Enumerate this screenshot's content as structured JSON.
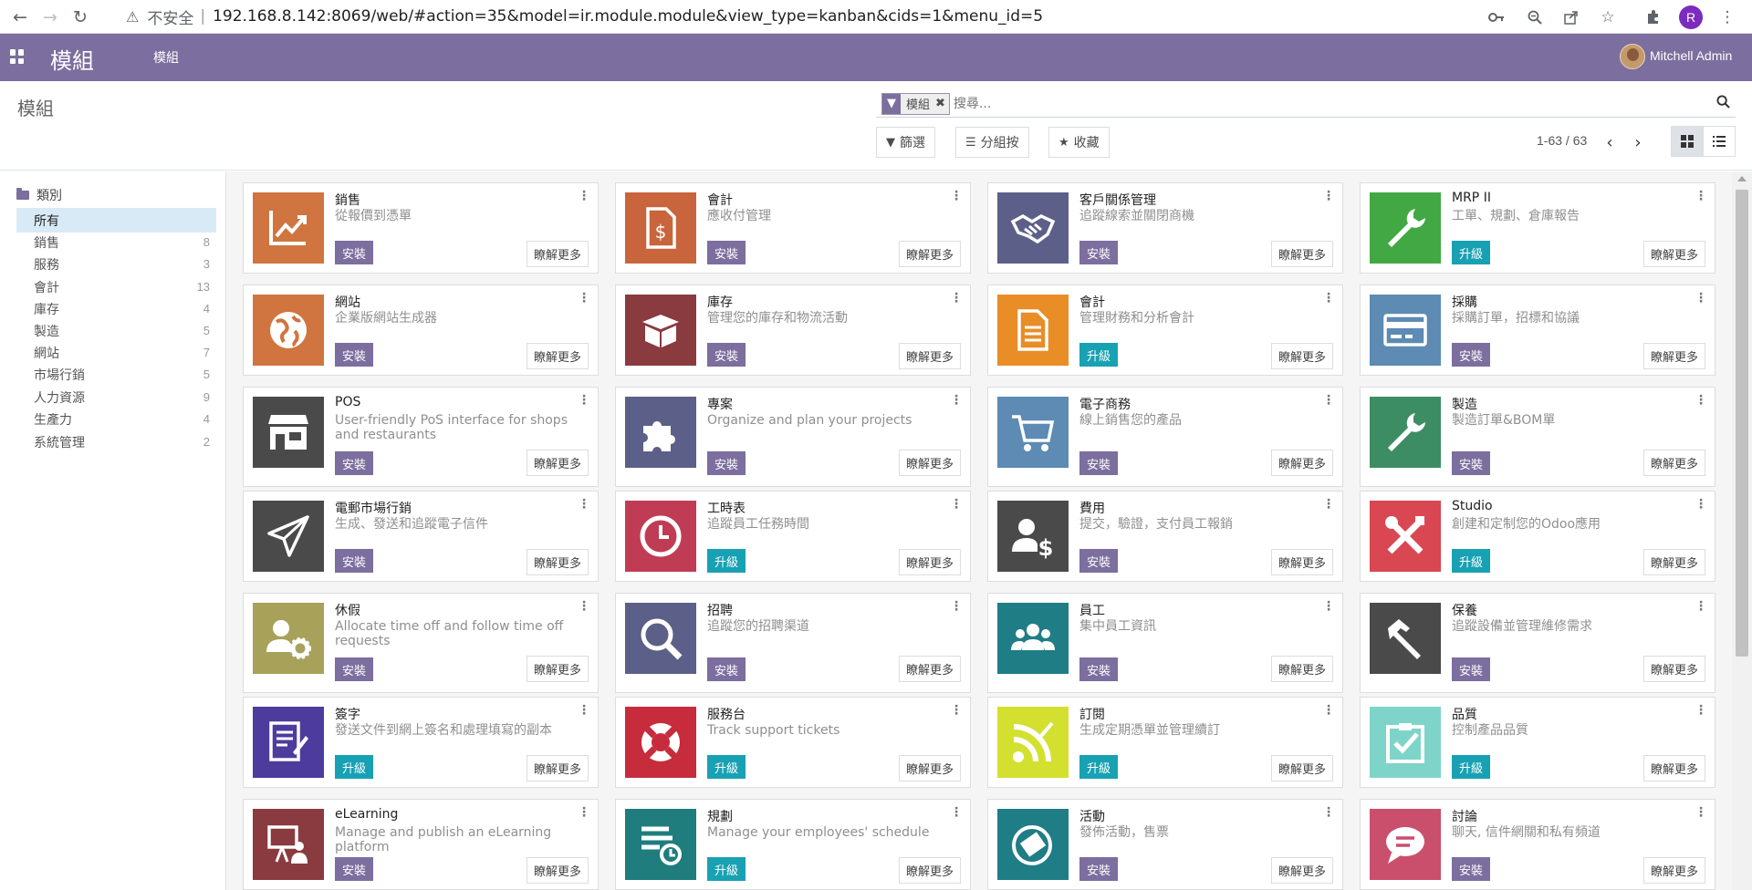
{
  "browser": {
    "insecure_label": "不安全",
    "url": "192.168.8.142:8069/web/#action=35&model=ir.module.module&view_type=kanban&cids=1&menu_id=5",
    "profile_initial": "R"
  },
  "navbar": {
    "brand": "模組",
    "menu_link": "模組",
    "user_name": "Mitchell Admin",
    "color": "#7c6e9e"
  },
  "control": {
    "title": "模組",
    "facet_label": "模組",
    "search_placeholder": "搜尋...",
    "filter_label": "篩選",
    "groupby_label": "分組按",
    "favorites_label": "收藏",
    "pager": "1-63 / 63"
  },
  "sidebar": {
    "heading": "類別",
    "items": [
      {
        "label": "所有",
        "count": ""
      },
      {
        "label": "銷售",
        "count": "8"
      },
      {
        "label": "服務",
        "count": "3"
      },
      {
        "label": "會計",
        "count": "13"
      },
      {
        "label": "庫存",
        "count": "4"
      },
      {
        "label": "製造",
        "count": "5"
      },
      {
        "label": "網站",
        "count": "7"
      },
      {
        "label": "市場行銷",
        "count": "5"
      },
      {
        "label": "人力資源",
        "count": "9"
      },
      {
        "label": "生產力",
        "count": "4"
      },
      {
        "label": "系統管理",
        "count": "2"
      }
    ]
  },
  "labels": {
    "install": "安裝",
    "upgrade": "升級",
    "learn_more": "瞭解更多"
  },
  "modules": [
    {
      "title": "銷售",
      "desc": "從報價到憑單",
      "action": "install",
      "color": "#d0753f",
      "icon": "chart-icon"
    },
    {
      "title": "會計",
      "desc": "應收付管理",
      "action": "install",
      "color": "#c9653c",
      "icon": "invoice-icon"
    },
    {
      "title": "客戶關係管理",
      "desc": "追蹤線索並關閉商機",
      "action": "install",
      "color": "#5c5f87",
      "icon": "handshake-icon"
    },
    {
      "title": "MRP II",
      "desc": "工單、規劃、倉庫報告",
      "action": "upgrade",
      "color": "#42a844",
      "icon": "wrench-icon"
    },
    {
      "title": "網站",
      "desc": "企業版網站生成器",
      "action": "install",
      "color": "#d0753f",
      "icon": "globe-icon"
    },
    {
      "title": "庫存",
      "desc": "管理您的庫存和物流活動",
      "action": "install",
      "color": "#8a3b3f",
      "icon": "box-icon"
    },
    {
      "title": "會計",
      "desc": "管理財務和分析會計",
      "action": "upgrade",
      "color": "#e98d27",
      "icon": "document-icon"
    },
    {
      "title": "採購",
      "desc": "採購訂單，招標和協議",
      "action": "install",
      "color": "#5d8bb3",
      "icon": "credit-card-icon"
    },
    {
      "title": "POS",
      "desc": "User-friendly PoS interface for shops and restaurants",
      "action": "install",
      "color": "#4a4a4a",
      "icon": "store-icon"
    },
    {
      "title": "專案",
      "desc": "Organize and plan your projects",
      "action": "install",
      "color": "#5c5f87",
      "icon": "puzzle-icon"
    },
    {
      "title": "電子商務",
      "desc": "線上銷售您的產品",
      "action": "install",
      "color": "#5d8bb3",
      "icon": "cart-icon"
    },
    {
      "title": "製造",
      "desc": "製造訂單&BOM單",
      "action": "install",
      "color": "#3d8d64",
      "icon": "wrench-icon"
    },
    {
      "title": "電郵市場行銷",
      "desc": "生成、發送和追蹤電子信件",
      "action": "install",
      "color": "#4a4a4a",
      "icon": "paper-plane-icon"
    },
    {
      "title": "工時表",
      "desc": "追蹤員工任務時間",
      "action": "upgrade",
      "color": "#c03c54",
      "icon": "clock-icon"
    },
    {
      "title": "費用",
      "desc": "提交，驗證，支付員工報銷",
      "action": "install",
      "color": "#4a4a4a",
      "icon": "expense-icon"
    },
    {
      "title": "Studio",
      "desc": "創建和定制您的Odoo應用",
      "action": "upgrade",
      "color": "#d84752",
      "icon": "tools-icon"
    },
    {
      "title": "休假",
      "desc": "Allocate time off and follow time off requests",
      "action": "install",
      "color": "#a8a15a",
      "icon": "user-gear-icon"
    },
    {
      "title": "招聘",
      "desc": "追蹤您的招聘渠道",
      "action": "install",
      "color": "#5c5f87",
      "icon": "magnifier-icon"
    },
    {
      "title": "員工",
      "desc": "集中員工資訊",
      "action": "install",
      "color": "#1f7d86",
      "icon": "people-icon"
    },
    {
      "title": "保養",
      "desc": "追蹤設備並管理維修需求",
      "action": "install",
      "color": "#4a4a4a",
      "icon": "hammer-icon"
    },
    {
      "title": "簽字",
      "desc": "發送文件到網上簽名和處理填寫的副本",
      "action": "upgrade",
      "color": "#4d3c9e",
      "icon": "sign-icon"
    },
    {
      "title": "服務台",
      "desc": "Track support tickets",
      "action": "upgrade",
      "color": "#c72c3c",
      "icon": "lifebuoy-icon"
    },
    {
      "title": "訂閱",
      "desc": "生成定期憑單並管理續訂",
      "action": "upgrade",
      "color": "#d4e02f",
      "icon": "rss-icon"
    },
    {
      "title": "品質",
      "desc": "控制產品品質",
      "action": "upgrade",
      "color": "#7fd4c9",
      "icon": "quality-icon"
    },
    {
      "title": "eLearning",
      "desc": "Manage and publish an eLearning platform",
      "action": "install",
      "color": "#8a3b3f",
      "icon": "presentation-icon"
    },
    {
      "title": "規劃",
      "desc": "Manage your employees' schedule",
      "action": "upgrade",
      "color": "#1f7d7d",
      "icon": "schedule-icon"
    },
    {
      "title": "活動",
      "desc": "發佈活動，售票",
      "action": "install",
      "color": "#1f7d86",
      "icon": "ticket-icon"
    },
    {
      "title": "討論",
      "desc": "聊天, 信件網關和私有頻道",
      "action": "install",
      "color": "#c94f6d",
      "icon": "chat-icon"
    }
  ]
}
